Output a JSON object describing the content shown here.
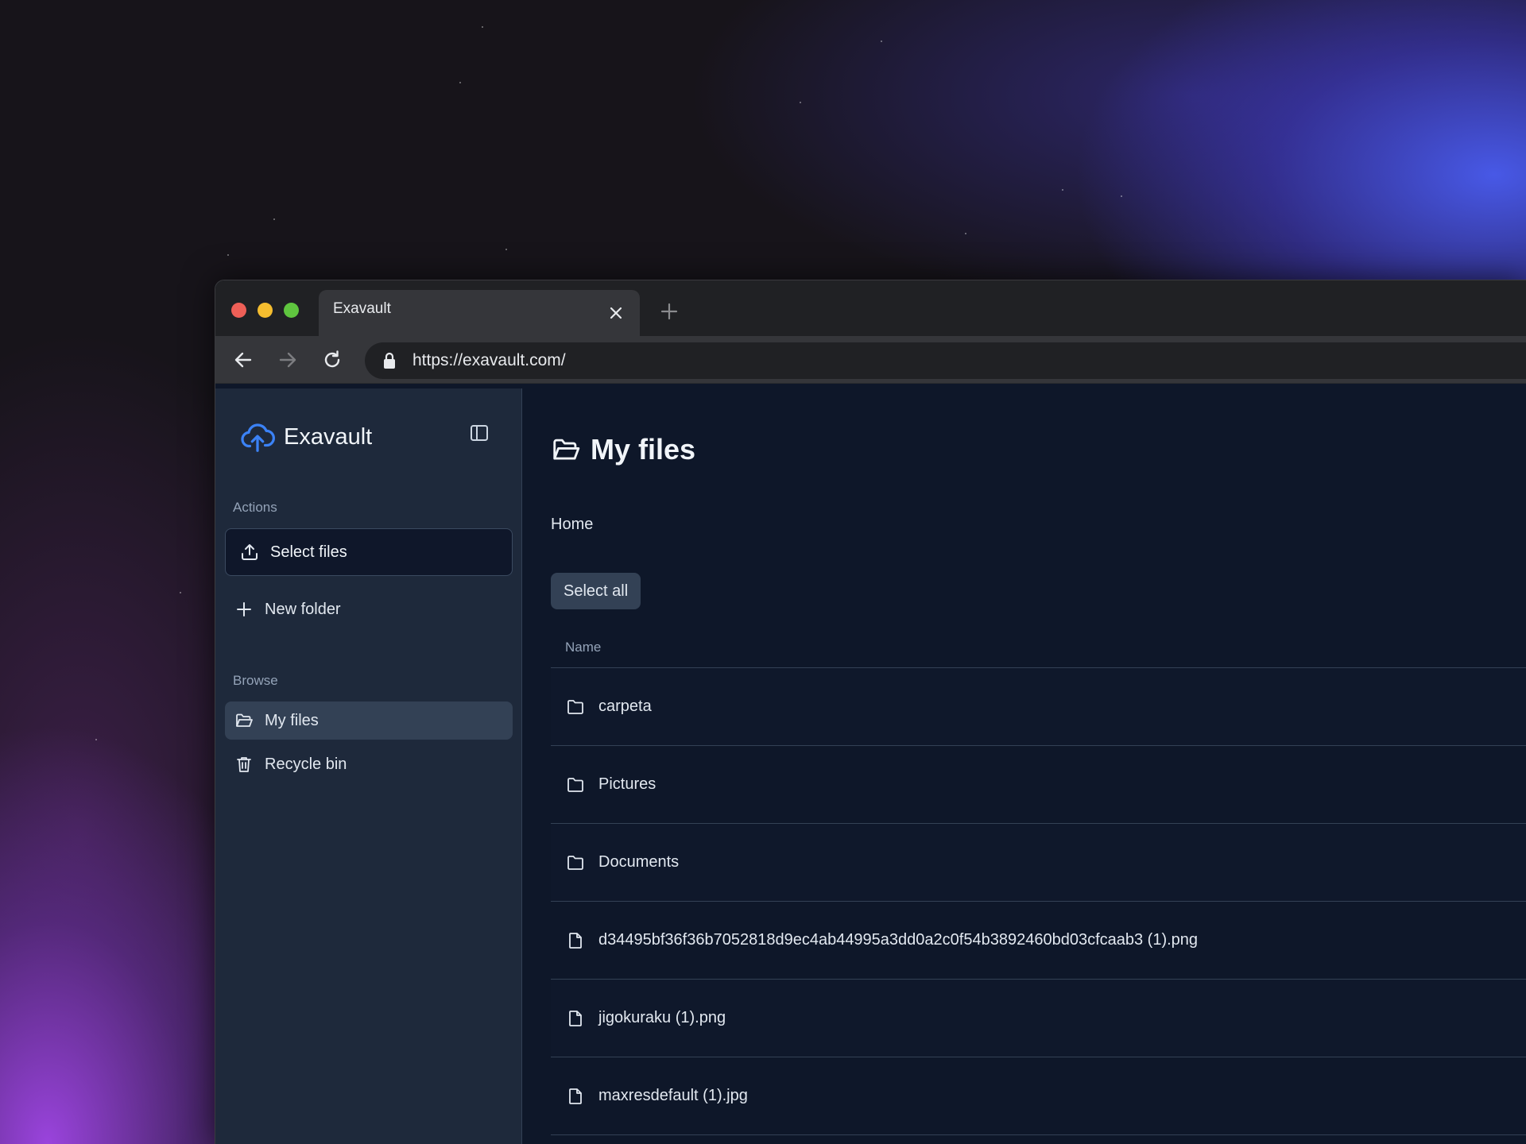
{
  "browser": {
    "tab_title": "Exavault",
    "url": "https://exavault.com/"
  },
  "sidebar": {
    "brand": "Exavault",
    "actions_label": "Actions",
    "select_files": "Select files",
    "new_folder": "New folder",
    "browse_label": "Browse",
    "items": [
      {
        "label": "My files",
        "icon": "folder-open-icon",
        "active": true
      },
      {
        "label": "Recycle bin",
        "icon": "trash-icon",
        "active": false
      }
    ]
  },
  "main": {
    "title": "My files",
    "breadcrumb": "Home",
    "select_all": "Select all",
    "columns": [
      "Name"
    ],
    "rows": [
      {
        "name": "carpeta",
        "type": "folder"
      },
      {
        "name": "Pictures",
        "type": "folder"
      },
      {
        "name": "Documents",
        "type": "folder"
      },
      {
        "name": "d34495bf36f36b7052818d9ec4ab44995a3dd0a2c0f54b3892460bd03cfcaab3 (1).png",
        "type": "file"
      },
      {
        "name": "jigokuraku (1).png",
        "type": "file"
      },
      {
        "name": "maxresdefault (1).jpg",
        "type": "file"
      }
    ]
  },
  "colors": {
    "accent": "#3b82f6",
    "sidebar_bg": "#1e293b",
    "main_bg": "#0e1729"
  }
}
